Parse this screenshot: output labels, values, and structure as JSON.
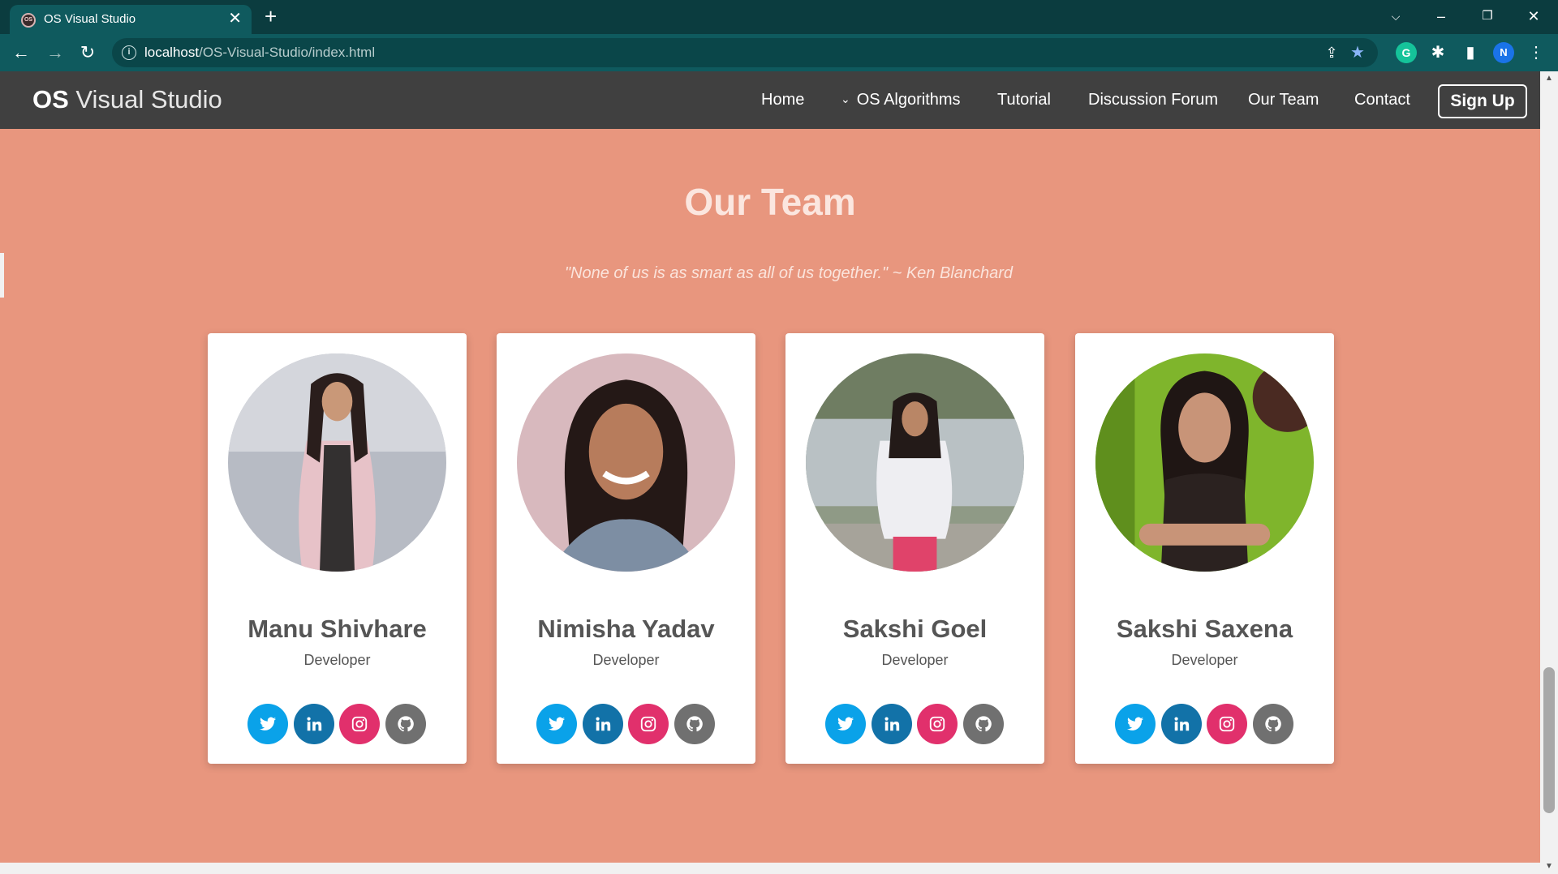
{
  "browser": {
    "tab_title": "OS Visual Studio",
    "favicon_text": "OS",
    "close_tab_glyph": "✕",
    "new_tab_glyph": "+",
    "url_host": "localhost",
    "url_path": "/OS-Visual-Studio/index.html",
    "profile_initial": "N",
    "extension_initial": "G"
  },
  "navbar": {
    "brand_bold": "OS",
    "brand_rest": " Visual Studio",
    "links": [
      {
        "label": "Home"
      },
      {
        "label": "OS Algorithms",
        "has_dropdown": true
      },
      {
        "label": "Tutorial"
      },
      {
        "label": "Discussion Forum"
      },
      {
        "label": "Our Team"
      },
      {
        "label": "Contact"
      }
    ],
    "signup_label": "Sign Up"
  },
  "section": {
    "title": "Our Team",
    "quote": "\"None of us is as smart as all of us together.\" ~ Ken Blanchard"
  },
  "team": [
    {
      "name": "Manu Shivhare",
      "role": "Developer"
    },
    {
      "name": "Nimisha Yadav",
      "role": "Developer"
    },
    {
      "name": "Sakshi Goel",
      "role": "Developer"
    },
    {
      "name": "Sakshi Saxena",
      "role": "Developer"
    }
  ],
  "colors": {
    "page_background": "#e8967e",
    "navbar": "#404040",
    "twitter": "#0aa2e9",
    "linkedin": "#1272a8",
    "instagram": "#e1306c",
    "github": "#707070"
  },
  "icons": [
    "twitter-icon",
    "linkedin-icon",
    "instagram-icon",
    "github-icon"
  ]
}
